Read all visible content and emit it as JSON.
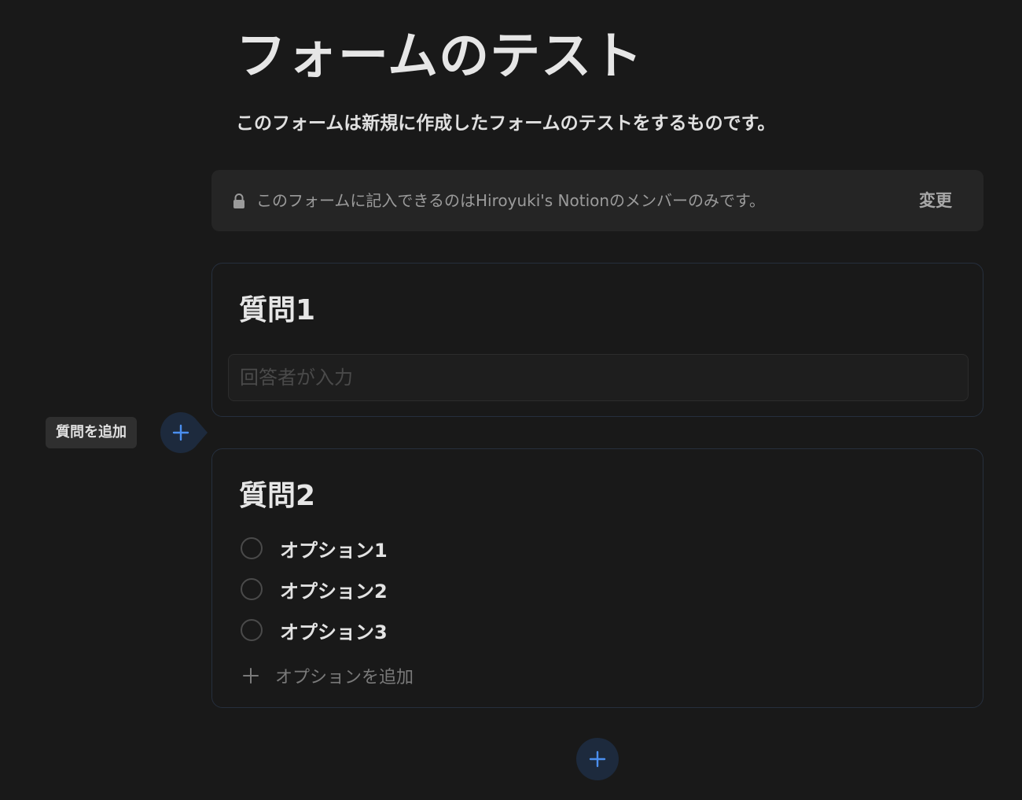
{
  "form": {
    "title": "フォームのテスト",
    "description": "このフォームは新規に作成したフォームのテストをするものです。"
  },
  "permission": {
    "text": "このフォームに記入できるのはHiroyuki's Notionのメンバーのみです。",
    "change_label": "変更",
    "icon": "lock-icon"
  },
  "questions": [
    {
      "title": "質問1",
      "input_placeholder": "回答者が入力"
    },
    {
      "title": "質問2",
      "options": [
        "オプション1",
        "オプション2",
        "オプション3"
      ],
      "add_option_label": "オプションを追加"
    }
  ],
  "add_question": {
    "tooltip": "質問を追加",
    "icon": "plus-icon"
  },
  "colors": {
    "background": "#191919",
    "accent": "#4b8ff0",
    "add_button_bg": "#1d2a3d"
  }
}
